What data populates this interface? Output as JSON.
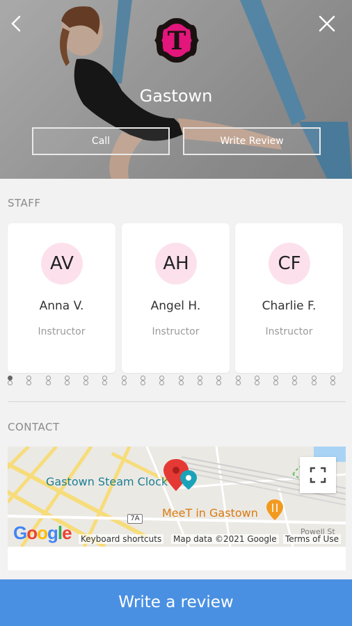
{
  "header": {
    "studio_name": "Gastown",
    "logo_letter": "T",
    "call_label": "Call",
    "write_review_label": "Write Review",
    "back_icon": "chevron-left-icon",
    "close_icon": "close-icon"
  },
  "staff": {
    "section_label": "STAFF",
    "members": [
      {
        "initials": "AV",
        "name": "Anna V.",
        "role": "Instructor"
      },
      {
        "initials": "AH",
        "name": "Angel H.",
        "role": "Instructor"
      },
      {
        "initials": "CF",
        "name": "Charlie F.",
        "role": "Instructor"
      }
    ],
    "pager_dot_count": 18,
    "pager_active_index": 0
  },
  "contact": {
    "section_label": "CONTACT",
    "map": {
      "place_1": "Gastown Steam Clock",
      "place_2": "MeeT in Gastown",
      "route_badge": "7A",
      "street_1": "Powell St",
      "google_logo": "Google",
      "keyboard_shortcuts": "Keyboard shortcuts",
      "map_data": "Map data ©2021 Google",
      "terms": "Terms of Use"
    }
  },
  "cta": {
    "label": "Write a review"
  },
  "colors": {
    "accent": "#4a90e2",
    "avatar_bg": "#fce1ec",
    "logo_pink": "#e2167b",
    "map_pin": "#e53935"
  }
}
